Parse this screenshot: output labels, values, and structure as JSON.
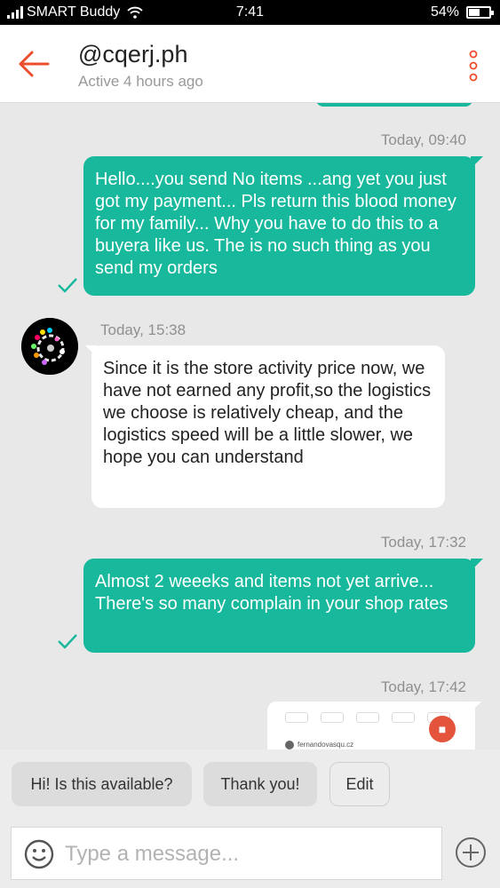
{
  "status": {
    "carrier": "SMART Buddy",
    "time": "7:41",
    "battery": "54%",
    "battery_level": 0.54
  },
  "header": {
    "title": "@cqerj.ph",
    "subtitle": "Active 4 hours ago"
  },
  "messages": [
    {
      "timestamp": "Today, 09:40",
      "direction": "outgoing",
      "text": "Hello....you send No items ...ang yet you just got my payment... Pls return this blood money for my family... Why you have to do this to a buyera like us. The is no such thing as you send my orders"
    },
    {
      "timestamp": "Today, 15:38",
      "direction": "incoming",
      "text": "Since it is the store activity price now, we have not earned any profit,so the logistics we choose is relatively cheap, and the logistics speed will be a little slower, we hope you can understand"
    },
    {
      "timestamp": "Today, 17:32",
      "direction": "outgoing",
      "text": "Almost 2 weeeks and items not yet arrive... There's so many complain in your shop rates"
    },
    {
      "timestamp": "Today, 17:42",
      "direction": "outgoing",
      "image_text": "fernandovasqu.cz"
    }
  ],
  "quick_replies": [
    "Hi! Is this available?",
    "Thank you!"
  ],
  "edit_label": "Edit",
  "input": {
    "placeholder": "Type a message..."
  },
  "colors": {
    "accent": "#17b89c",
    "brand": "#ee4d2d",
    "chat_bg": "#e8e8e8"
  },
  "icons": [
    "back-arrow-icon",
    "more-options-icon",
    "checkmark-icon",
    "emoji-icon",
    "plus-icon",
    "wifi-icon",
    "signal-icon",
    "battery-icon"
  ]
}
